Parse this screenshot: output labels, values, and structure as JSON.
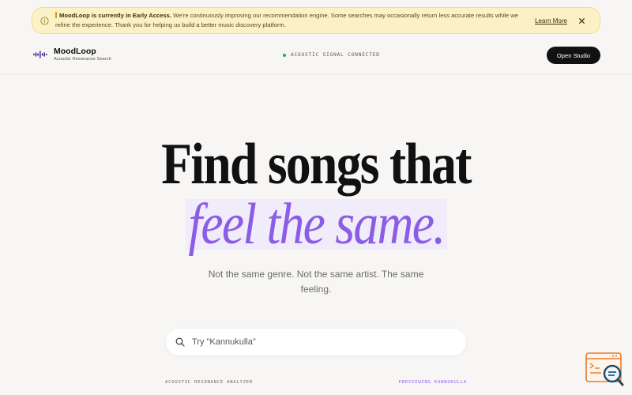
{
  "banner": {
    "icon": "info-icon",
    "bold_text": "MoodLoop is currently in Early Access.",
    "message": "We're continuously improving our recommendation engine. Some searches may occasionally return less accurate results while we refine the experience. Thank you for helping us build a better music discovery platform.",
    "learn_more": "Learn More",
    "close_icon": "close-icon",
    "accent_color": "#d79a11"
  },
  "header": {
    "brand_name": "MoodLoop",
    "brand_tagline": "Acoustic Resonance Search",
    "logo_icon": "waveform-logo-icon",
    "status_text": "ACOUSTIC SIGNAL CONNECTED",
    "status_color": "#22a66b",
    "open_studio_label": "Open Studio"
  },
  "hero": {
    "line1": "Find songs that",
    "line2": "feel the same.",
    "accent_color": "#8b5ce6",
    "subtitle": "Not the same genre. Not the same artist. The same feeling."
  },
  "search": {
    "icon": "search-icon",
    "placeholder": "Try \"Kannukulla\"",
    "value": ""
  },
  "footer_labels": {
    "left": "ACOUSTIC RESONANCE ANALYZER",
    "right": "PREVIEWING KANNUKULLA"
  },
  "widget": {
    "icon": "terminal-search-icon"
  }
}
